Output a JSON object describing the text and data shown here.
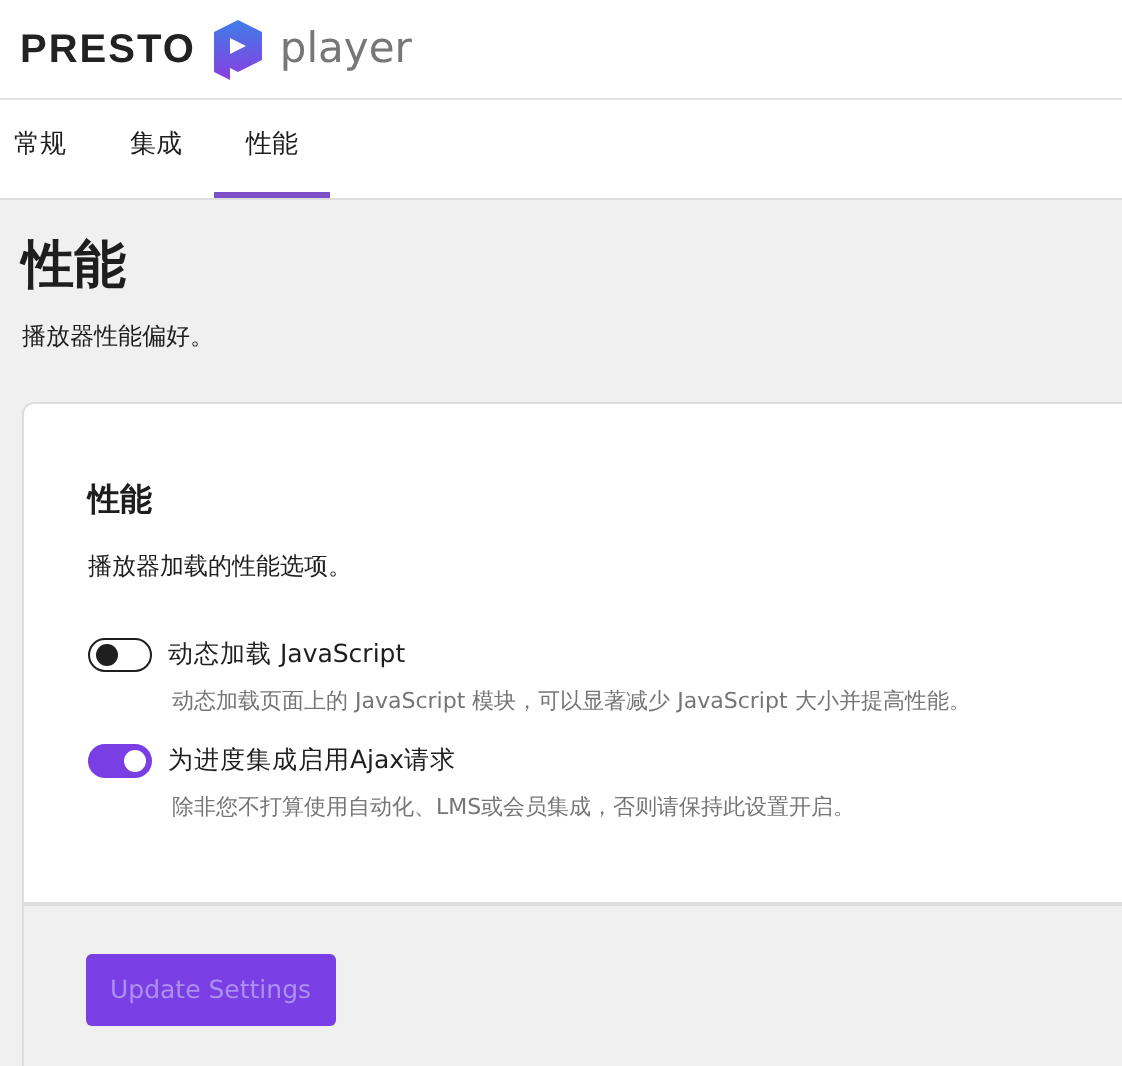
{
  "logo": {
    "brand": "PRESTO",
    "product": "player"
  },
  "tabs": [
    {
      "label": "常规",
      "selected": false
    },
    {
      "label": "集成",
      "selected": false
    },
    {
      "label": "性能",
      "selected": true
    }
  ],
  "page": {
    "title": "性能",
    "subtitle": "播放器性能偏好。"
  },
  "card": {
    "title": "性能",
    "subtitle": "播放器加载的性能选项。",
    "settings": [
      {
        "label": "动态加载 JavaScript",
        "help": "动态加载页面上的 JavaScript 模块，可以显著减少 JavaScript 大小并提高性能。",
        "on": false
      },
      {
        "label": "为进度集成启用Ajax请求",
        "help": "除非您不打算使用自动化、LMS或会员集成，否则请保持此设置开启。",
        "on": true
      }
    ]
  },
  "button": {
    "label": "Update Settings",
    "disabled": true
  }
}
